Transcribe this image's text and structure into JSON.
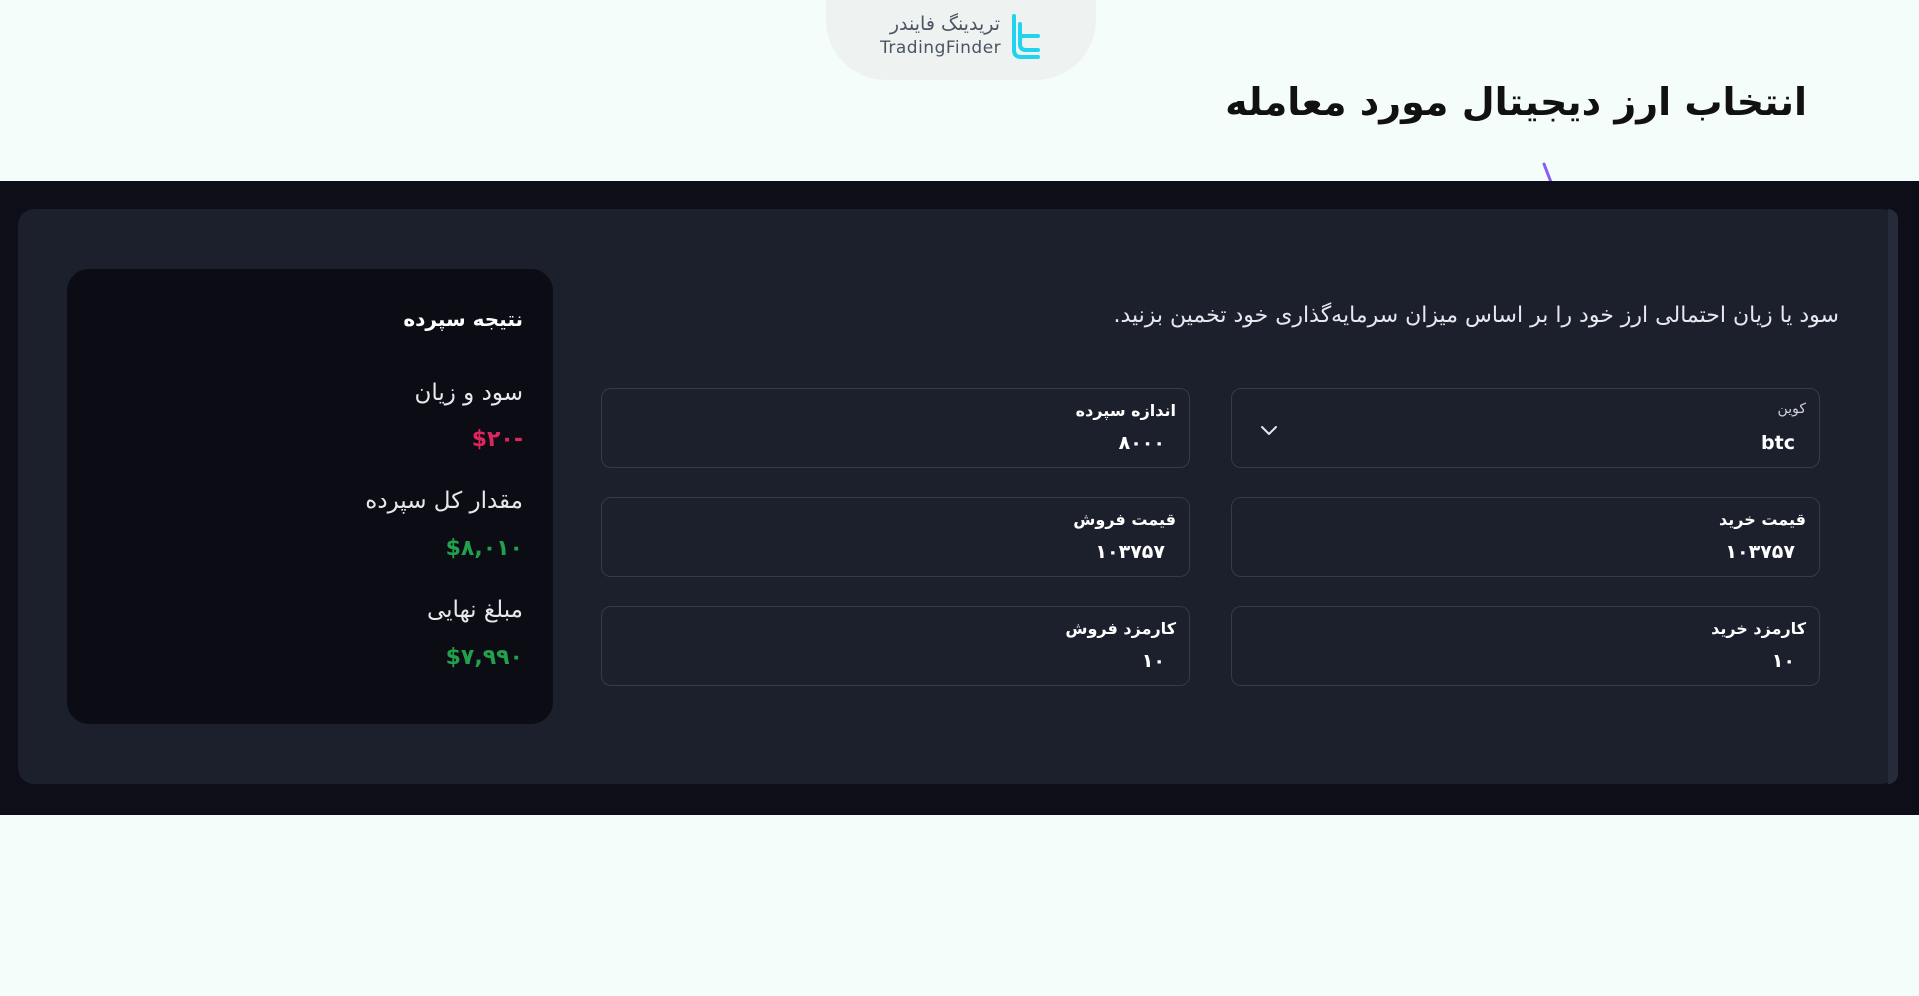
{
  "brand": {
    "name_fa": "تریدینگ فایندر",
    "name_en": "TradingFinder",
    "accent_color": "#22d3ee"
  },
  "heading": "انتخاب ارز دیجیتال مورد معامله",
  "annotation": {
    "arrow_color": "#8a5cf6"
  },
  "calculator": {
    "description": "سود یا زیان احتمالی ارز خود را بر اساس میزان سرمایه‌گذاری خود تخمین بزنید.",
    "fields": {
      "coin": {
        "label": "کوین",
        "value": "btc",
        "icon": "chevron-down-icon"
      },
      "deposit_size": {
        "label": "اندازه سپرده",
        "value": "۸۰۰۰"
      },
      "buy_price": {
        "label": "قیمت خرید",
        "value": "۱۰۳۷۵۷"
      },
      "sell_price": {
        "label": "قیمت فروش",
        "value": "۱۰۳۷۵۷"
      },
      "buy_fee": {
        "label": "کارمزد خرید",
        "value": "۱۰"
      },
      "sell_fee": {
        "label": "کارمزد فروش",
        "value": "۱۰"
      }
    }
  },
  "result": {
    "title": "نتیجه سپرده",
    "profit_loss": {
      "label": "سود و زیان",
      "value": "-$۲۰",
      "color": "#e0245e"
    },
    "total_deposit": {
      "label": "مقدار کل سپرده",
      "value": "$۸,۰۱۰",
      "color": "#22a04b"
    },
    "final_amount": {
      "label": "مبلغ نهایی",
      "value": "$۷,۹۹۰",
      "color": "#22a04b"
    }
  }
}
